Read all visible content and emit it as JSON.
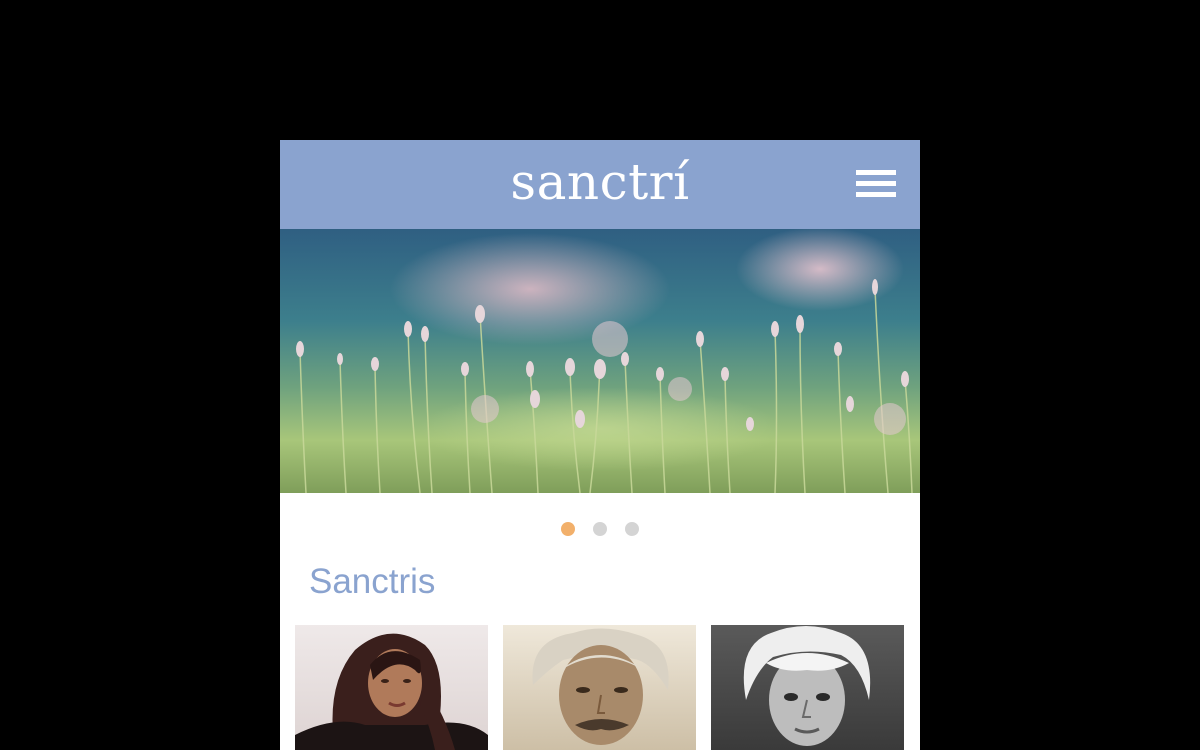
{
  "header": {
    "brand": "sanctrí",
    "menu_icon": "hamburger-menu-icon",
    "background_color": "#8aa3cf"
  },
  "hero": {
    "image": "meadow-flowers-photo",
    "slides_total": 3,
    "active_slide": 1
  },
  "carousel": {
    "active_color": "#f2b06b",
    "inactive_color": "#d4d4d4"
  },
  "section": {
    "title": "Sanctris"
  },
  "profiles": [
    {
      "image": "portrait-woman-dark-hair-photo"
    },
    {
      "image": "portrait-man-white-hair-mustache-photo"
    },
    {
      "image": "portrait-man-white-hair-photo"
    }
  ]
}
